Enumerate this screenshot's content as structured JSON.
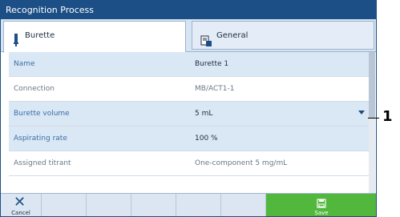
{
  "window": {
    "title": "Recognition Process"
  },
  "tabs": [
    {
      "label": "Burette",
      "icon": "burette-icon",
      "active": true
    },
    {
      "label": "General",
      "icon": "general-settings-icon",
      "active": false
    }
  ],
  "rows": [
    {
      "label": "Name",
      "value": "Burette 1"
    },
    {
      "label": "Connection",
      "value": "MB/ACT1-1"
    },
    {
      "label": "Burette volume",
      "value": "5 mL"
    },
    {
      "label": "Aspirating rate",
      "value": "100  %"
    },
    {
      "label": "Assigned titrant",
      "value": "One-component 5 mg/mL"
    }
  ],
  "toolbar": {
    "cancel_label": "Cancel",
    "save_label": "Save"
  },
  "callout": {
    "number": "1"
  },
  "colors": {
    "title_bar": "#1c4f86",
    "tab_bar": "#d7e4f3",
    "row_highlight": "#dae7f5",
    "save": "#52b83d"
  }
}
